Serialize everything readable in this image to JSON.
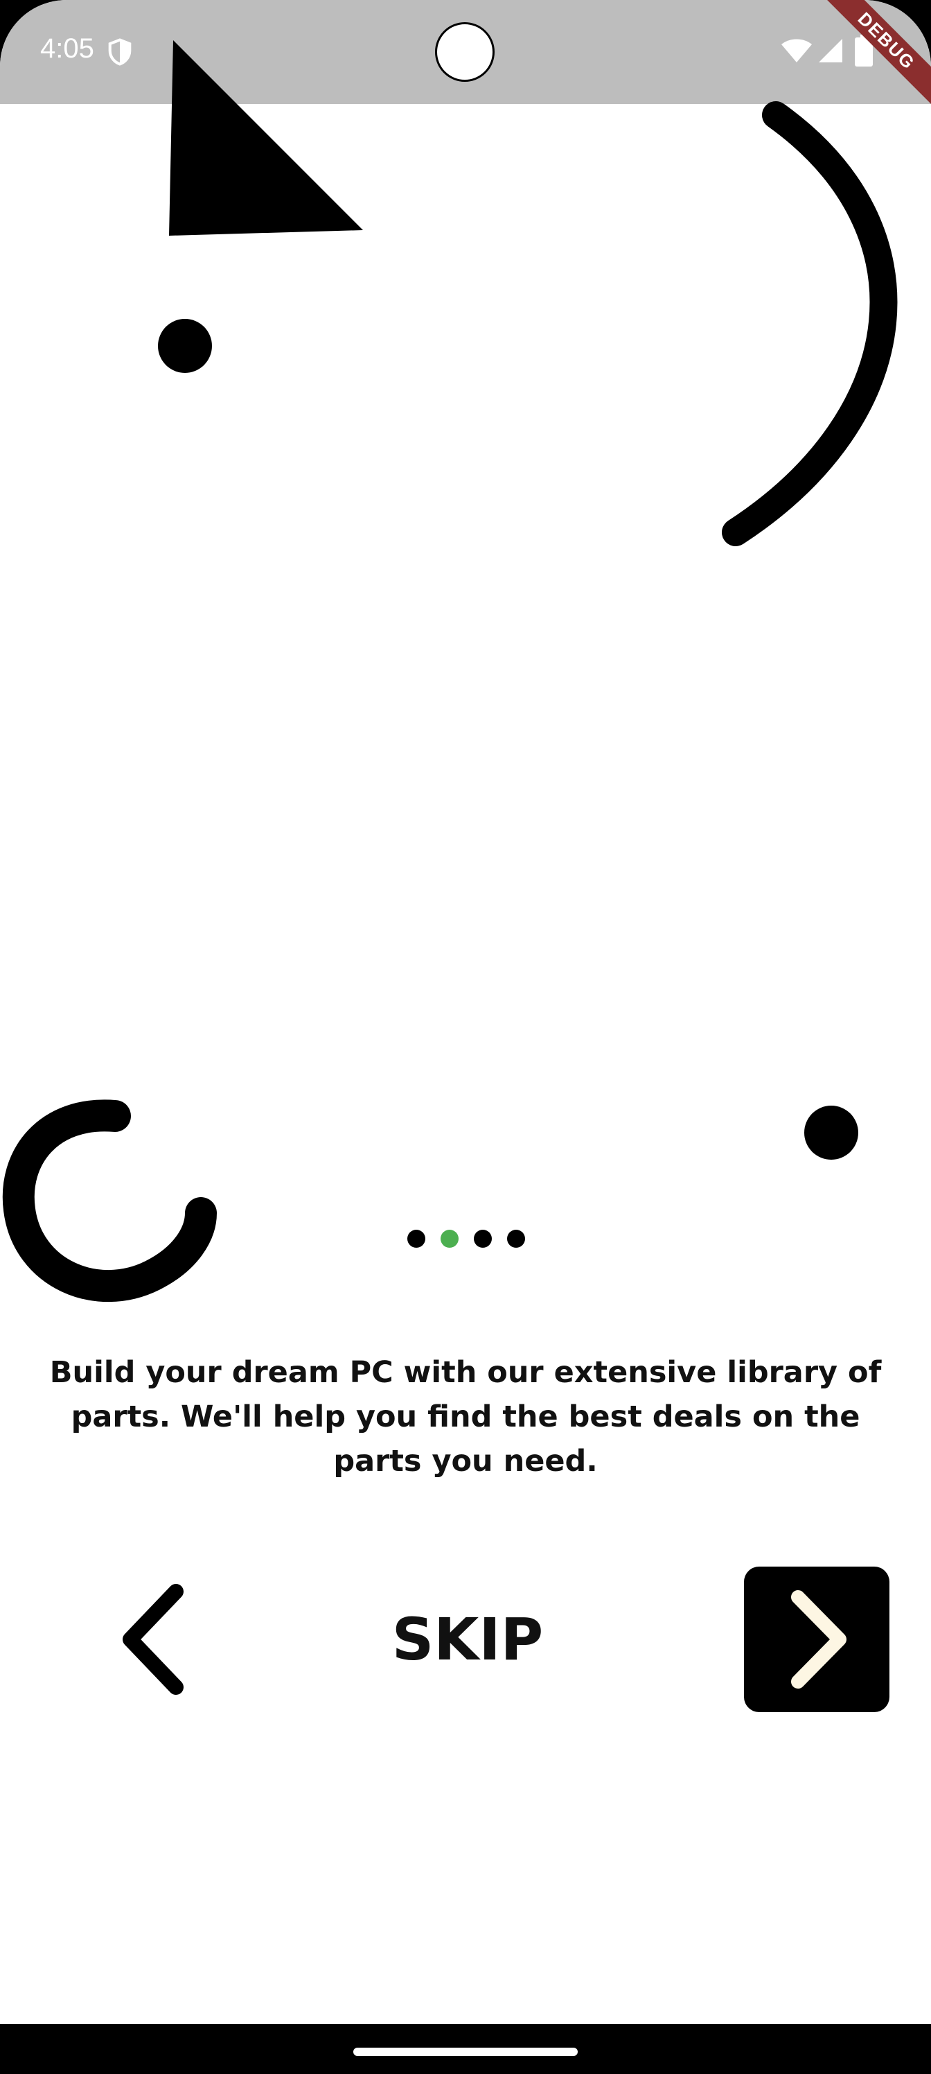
{
  "status_bar": {
    "time": "4:05",
    "icons": [
      "shield-icon",
      "wifi-icon",
      "signal-icon",
      "battery-icon"
    ]
  },
  "debug_banner": {
    "label": "DEBUG"
  },
  "onboarding": {
    "page_indicator": {
      "count": 4,
      "active_index": 1,
      "active_color": "#4caf50",
      "inactive_color": "#000000"
    },
    "description": "Build your dream PC with our extensive library of parts. We'll help you find the best deals on the parts you need."
  },
  "controls": {
    "back_icon": "chevron-left-icon",
    "skip_label": "SKIP",
    "next_icon": "chevron-right-icon",
    "next_icon_color": "#fdf6e3"
  },
  "colors": {
    "status_bar": "#bdbdbd",
    "background": "#ffffff",
    "shape_color": "#000000"
  }
}
